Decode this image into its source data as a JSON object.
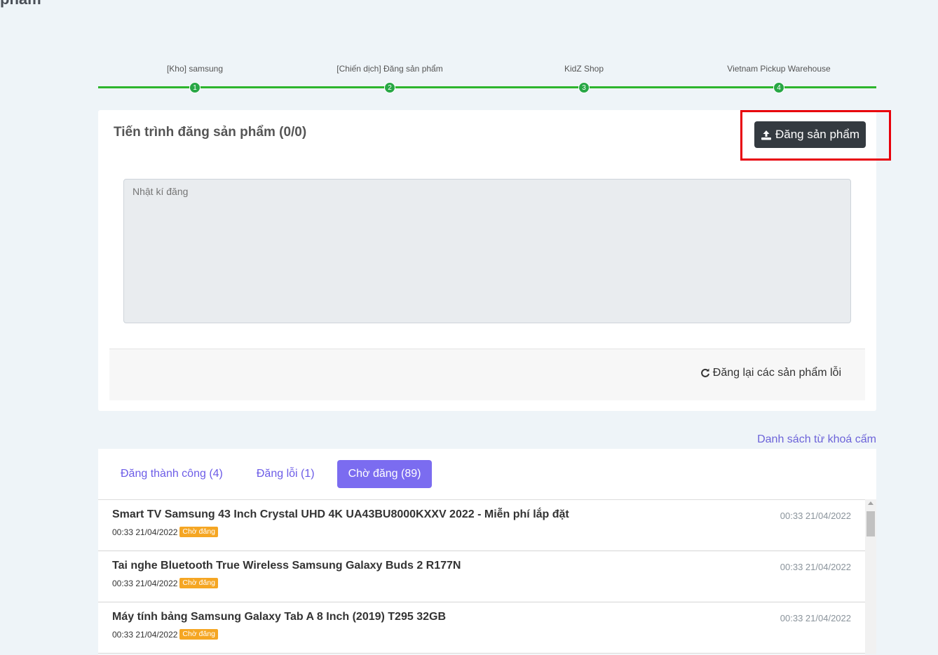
{
  "page": {
    "title_partial": "phẩm"
  },
  "stepper": {
    "steps": [
      {
        "number": "1",
        "label": "[Kho] samsung"
      },
      {
        "number": "2",
        "label": "[Chiến dịch] Đăng sản phẩm"
      },
      {
        "number": "3",
        "label": "KidZ Shop"
      },
      {
        "number": "4",
        "label": "Vietnam Pickup Warehouse"
      }
    ]
  },
  "progress": {
    "title": "Tiến trình đăng sản phẩm (0/0)",
    "upload_button": "Đăng sản phẩm",
    "log_placeholder": "Nhật kí đăng",
    "retry_button": "Đăng lại các sản phẩm lỗi"
  },
  "forbidden_keywords_link": "Danh sách từ khoá cấm",
  "tabs": [
    {
      "label": "Đăng thành công (4)",
      "active": false
    },
    {
      "label": "Đăng lỗi (1)",
      "active": false
    },
    {
      "label": "Chờ đăng (89)",
      "active": true
    }
  ],
  "items": [
    {
      "title": "Smart TV Samsung 43 Inch Crystal UHD 4K UA43BU8000KXXV 2022 - Miễn phí lắp đặt",
      "created": "00:33 21/04/2022",
      "status": "Chờ đăng",
      "time": "00:33 21/04/2022"
    },
    {
      "title": "Tai nghe Bluetooth True Wireless Samsung Galaxy Buds 2 R177N",
      "created": "00:33 21/04/2022",
      "status": "Chờ đăng",
      "time": "00:33 21/04/2022"
    },
    {
      "title": "Máy tính bảng Samsung Galaxy Tab A 8 Inch (2019) T295 32GB",
      "created": "00:33 21/04/2022",
      "status": "Chờ đăng",
      "time": "00:33 21/04/2022"
    }
  ],
  "colors": {
    "accent": "#7b6cf0",
    "step_green": "#28a745",
    "badge": "#f5a623",
    "highlight": "#e8000b",
    "dark_button": "#343a40"
  },
  "icons": {
    "upload": "upload-icon",
    "retry": "refresh-icon"
  }
}
